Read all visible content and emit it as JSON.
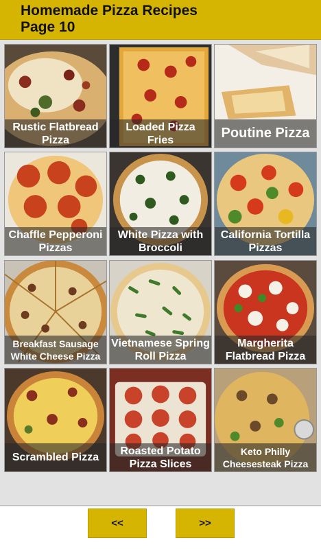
{
  "header": {
    "title_line1": "Homemade Pizza Recipes",
    "title_line2": "Page 10"
  },
  "recipes": [
    {
      "label": "Rustic Flatbread Pizza"
    },
    {
      "label": "Loaded Pizza Fries"
    },
    {
      "label": "Poutine Pizza"
    },
    {
      "label": "Chaffle Pepperoni Pizzas"
    },
    {
      "label": "White Pizza with Broccoli"
    },
    {
      "label": "California Tortilla Pizzas"
    },
    {
      "label": "Breakfast Sausage White Cheese Pizza"
    },
    {
      "label": "Vietnamese Spring Roll Pizza"
    },
    {
      "label": "Margherita Flatbread Pizza"
    },
    {
      "label": "Scrambled Pizza"
    },
    {
      "label": "Roasted Potato Pizza Slices"
    },
    {
      "label": "Keto Philly Cheesesteak Pizza"
    }
  ],
  "nav": {
    "prev_label": "<<",
    "next_label": ">>"
  },
  "colors": {
    "accent": "#d6b402",
    "background": "#e2e2e2"
  }
}
